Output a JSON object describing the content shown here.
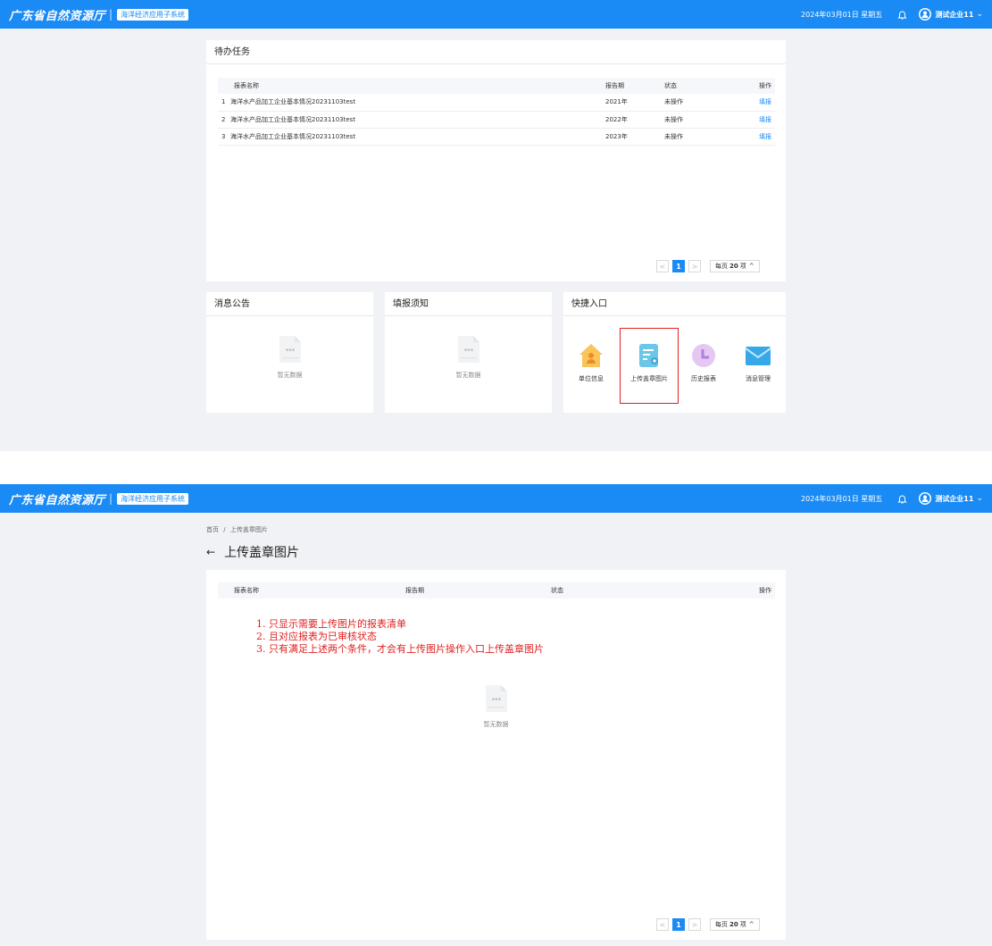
{
  "topbar": {
    "brand": "广东省自然资源厅",
    "separator": "|",
    "system_badge": "海洋经济应用子系统",
    "date": "2024年03月01日 星期五",
    "user": "测试企业11"
  },
  "screen1": {
    "pending": {
      "title": "待办任务",
      "columns": [
        "报表名称",
        "报告期",
        "状态",
        "操作"
      ],
      "rows": [
        {
          "index": "1",
          "name": "海洋水产品加工企业基本情况20231103test",
          "period": "2021年",
          "status": "未操作",
          "action": "填报"
        },
        {
          "index": "2",
          "name": "海洋水产品加工企业基本情况20231103test",
          "period": "2022年",
          "status": "未操作",
          "action": "填报"
        },
        {
          "index": "3",
          "name": "海洋水产品加工企业基本情况20231103test",
          "period": "2023年",
          "status": "未操作",
          "action": "填报"
        }
      ],
      "pager": {
        "prev": "<",
        "page": "1",
        "next": ">",
        "size_prefix": "每页",
        "size": "20",
        "size_suffix": "项",
        "size_arrow": "^"
      }
    },
    "notices": {
      "title": "消息公告",
      "empty_text": "暂无数据"
    },
    "instructions": {
      "title": "填报须知",
      "empty_text": "暂无数据"
    },
    "quick": {
      "title": "快捷入口",
      "items": [
        {
          "label": "单位信息",
          "icon": "house-person-icon"
        },
        {
          "label": "上传盖章图片",
          "icon": "document-upload-icon"
        },
        {
          "label": "历史报表",
          "icon": "clock-icon"
        },
        {
          "label": "消息管理",
          "icon": "envelope-icon"
        }
      ]
    }
  },
  "screen2": {
    "breadcrumb": {
      "home": "首页",
      "sep": "/",
      "current": "上传盖章图片"
    },
    "title": "上传盖章图片",
    "back": "←",
    "columns": [
      "报表名称",
      "报告期",
      "状态",
      "操作"
    ],
    "notes": [
      "1. 只显示需要上传图片的报表清单",
      "2. 且对应报表为已审核状态",
      "3. 只有满足上述两个条件，才会有上传图片操作入口上传盖章图片"
    ],
    "empty_text": "暂无数据",
    "pager": {
      "prev": "<",
      "page": "1",
      "next": ">",
      "size_prefix": "每页",
      "size": "20",
      "size_suffix": "项",
      "size_arrow": "^"
    }
  },
  "colors": {
    "primary": "#1a8af5",
    "highlight": "#e02020",
    "background": "#f0f2f5"
  }
}
